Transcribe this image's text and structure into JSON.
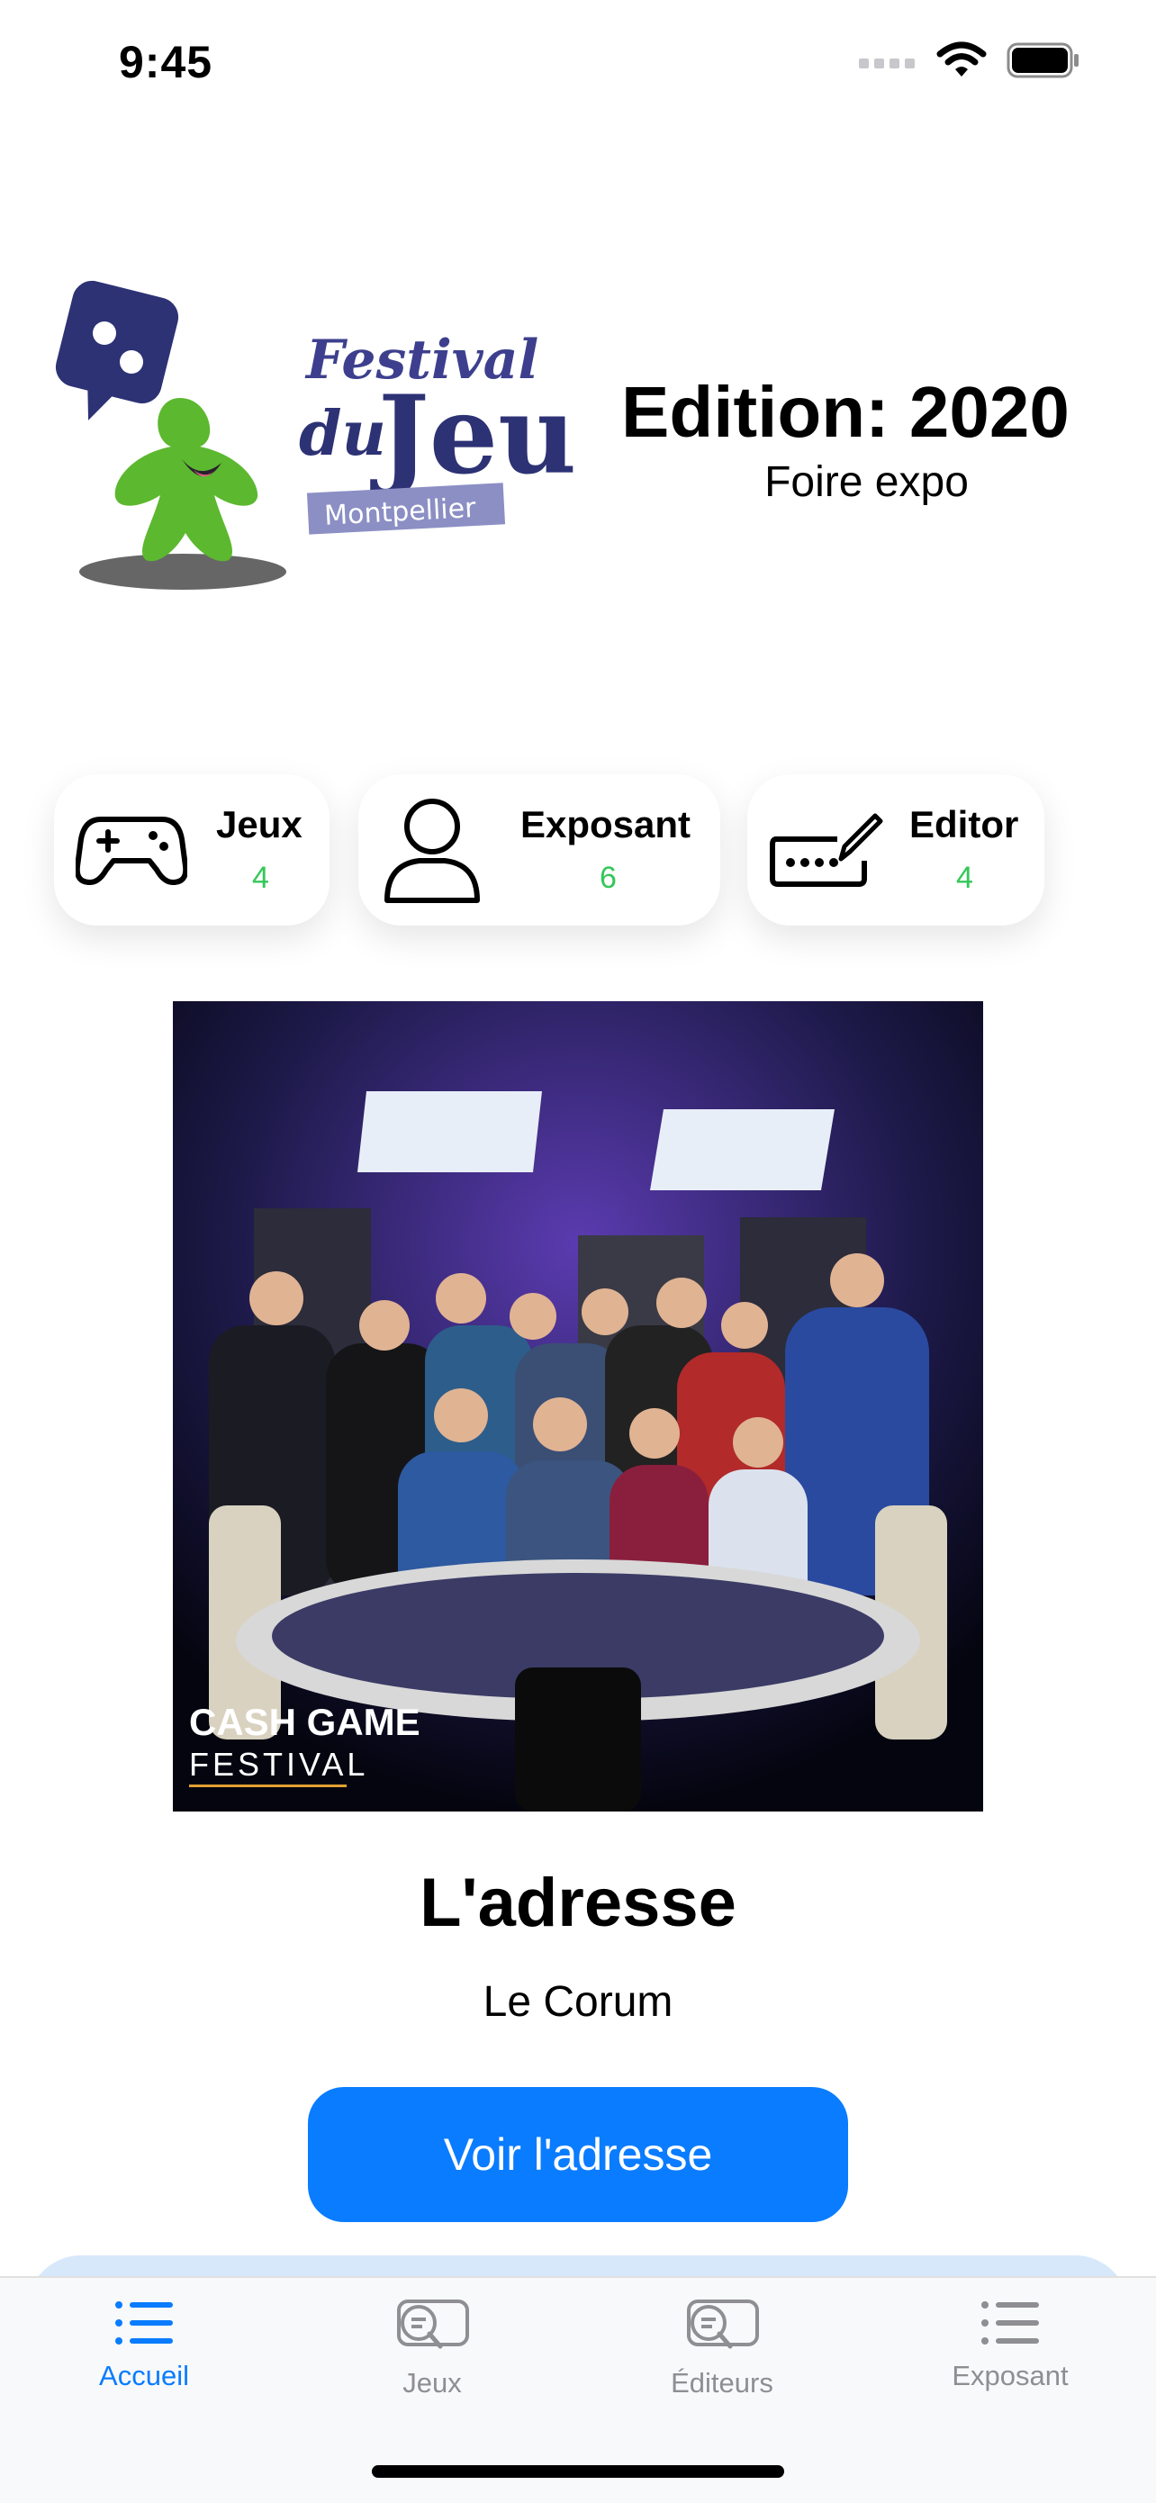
{
  "status_bar": {
    "time": "9:45"
  },
  "header": {
    "logo": {
      "line1": "Festival",
      "line2a": "du",
      "line2b": "Jeu",
      "tag": "Montpellier"
    },
    "edition": "Edition: 2020",
    "venue_type": "Foire expo"
  },
  "stats": [
    {
      "label": "Jeux",
      "count": "4",
      "icon": "gamepad-icon"
    },
    {
      "label": "Exposant",
      "count": "6",
      "icon": "person-icon"
    },
    {
      "label": "Editor",
      "count": "4",
      "icon": "keyboard-pen-icon"
    }
  ],
  "photo": {
    "caption_line1": "CASH GAME",
    "caption_line2": "FESTIVAL"
  },
  "address": {
    "title": "L'adresse",
    "value": "Le Corum",
    "button": "Voir l'adresse"
  },
  "tabs": [
    {
      "label": "Accueil",
      "icon": "list-icon",
      "active": true
    },
    {
      "label": "Jeux",
      "icon": "search-chat-icon",
      "active": false
    },
    {
      "label": "Éditeurs",
      "icon": "search-chat-icon",
      "active": false
    },
    {
      "label": "Exposant",
      "icon": "list-icon",
      "active": false
    }
  ],
  "colors": {
    "accent": "#0a7cff",
    "count": "#34c759",
    "inactive_tab": "#8e8e93"
  }
}
